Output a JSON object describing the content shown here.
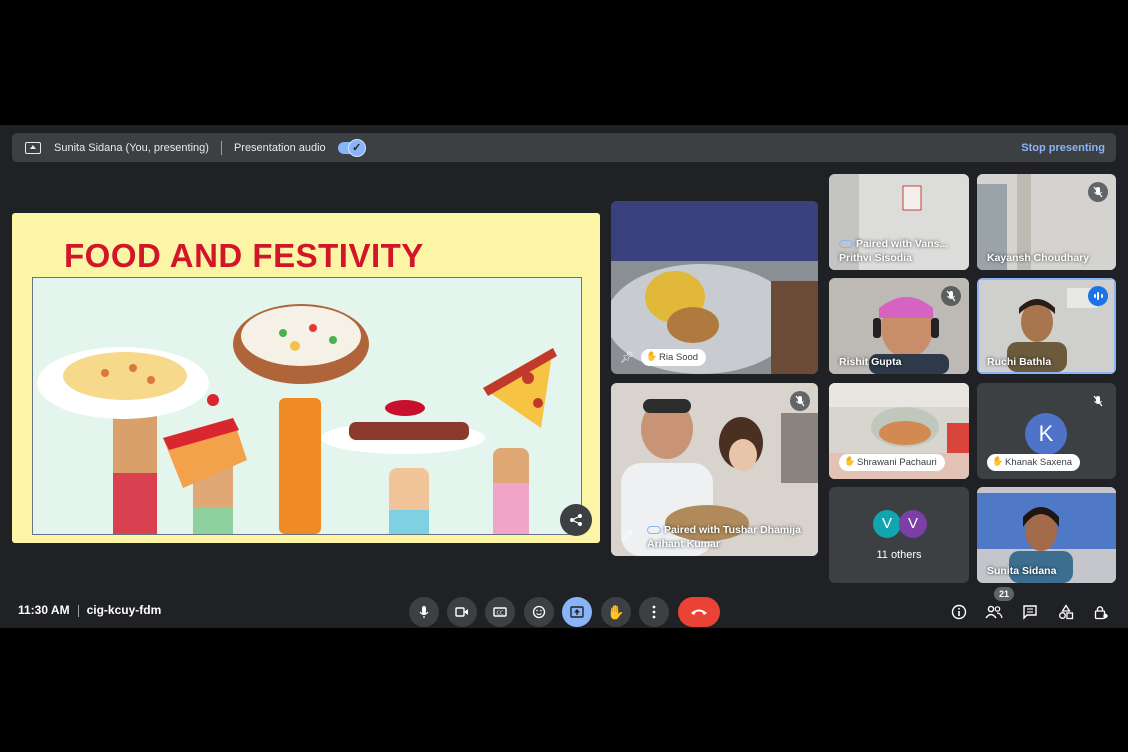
{
  "topbar": {
    "presenter_label": "Sunita Sidana (You, presenting)",
    "audio_label": "Presentation audio",
    "audio_enabled": true,
    "stop_label": "Stop presenting"
  },
  "slide": {
    "title": "FOOD AND FESTIVITY"
  },
  "participants": [
    {
      "name": "Ria Sood",
      "style": "pill",
      "pinned": true
    },
    {
      "name": "Arihant Kumar",
      "paired": "Paired with Tushar Dhamija",
      "muted": true,
      "pinned": true
    },
    {
      "name": "Prithvi Sisodia",
      "paired": "Paired with Vans..."
    },
    {
      "name": "Kayansh Choudhary",
      "muted": true
    },
    {
      "name": "Rishit Gupta",
      "muted": true
    },
    {
      "name": "Ruchi Bathla",
      "speaking": true
    },
    {
      "name": "Shrawani Pachauri",
      "style": "pill"
    },
    {
      "name": "Khanak Saxena",
      "style": "pill",
      "muted": true,
      "avatar_letter": "K"
    },
    {
      "name": "Sunita Sidana"
    }
  ],
  "others": {
    "label": "11 others",
    "avatars": [
      "V",
      "V"
    ],
    "colors": [
      "#12a4af",
      "#7b3fa7"
    ]
  },
  "bottom": {
    "time": "11:30 AM",
    "meeting_code": "cig-kcuy-fdm",
    "participant_count": "21"
  },
  "colors": {
    "accent": "#8ab4f8",
    "end_call": "#ea4335",
    "background": "#202124"
  }
}
